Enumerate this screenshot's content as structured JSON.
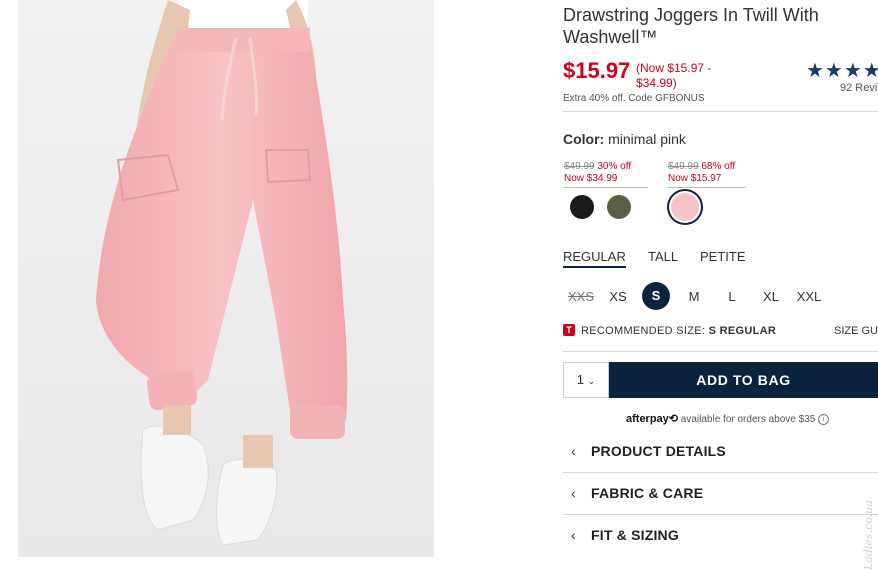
{
  "product": {
    "title": "Drawstring Joggers In Twill With Washwell™",
    "price": "$15.97",
    "price_range": "(Now $15.97 - $34.99)",
    "promo": "Extra 40% off. Code GFBONUS",
    "stars": "★★★★",
    "reviews": "92 Revi"
  },
  "color": {
    "label": "Color:",
    "value": "minimal pink",
    "price_groups": [
      {
        "orig": "$49.99",
        "discount": "30% off",
        "now": "Now $34.99"
      },
      {
        "orig": "$49.99",
        "discount": "68% off",
        "now": "Now $15.97"
      }
    ],
    "swatches": [
      {
        "name": "black",
        "hex": "#1a1a1a"
      },
      {
        "name": "olive",
        "hex": "#5c5f47"
      },
      {
        "name": "minimal pink",
        "hex": "#f7c3c6"
      }
    ]
  },
  "fit_tabs": [
    "REGULAR",
    "TALL",
    "PETITE"
  ],
  "sizes": [
    "XXS",
    "XS",
    "S",
    "M",
    "L",
    "XL",
    "XXL"
  ],
  "recommendation": {
    "badge": "T",
    "label": "RECOMMENDED SIZE:",
    "value": "S REGULAR",
    "size_guide": "SIZE GU"
  },
  "cart": {
    "qty": "1",
    "add_label": "ADD TO BAG"
  },
  "afterpay": {
    "logo": "afterpay⟲",
    "text": "available for orders above $35",
    "info": "i"
  },
  "accordions": [
    "PRODUCT DETAILS",
    "FABRIC & CARE",
    "FIT & SIZING"
  ],
  "watermark": "Ladies.co.ua",
  "colors": {
    "brand_navy": "#0c2340",
    "sale_red": "#d0021b",
    "pink": "#f7c3c6"
  }
}
